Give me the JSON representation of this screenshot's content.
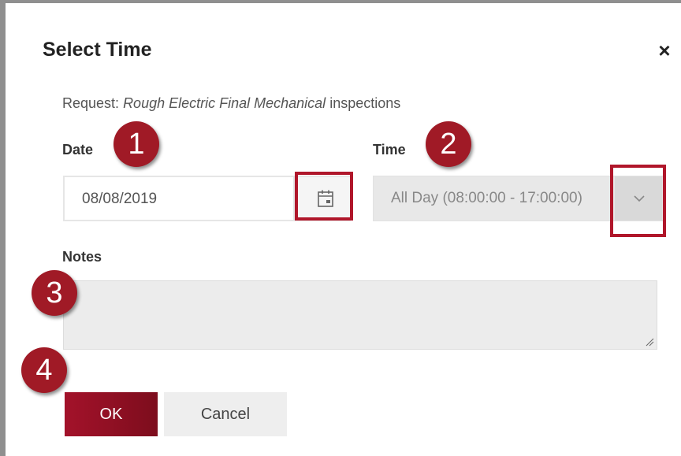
{
  "dialog": {
    "title": "Select Time",
    "close_label": "×",
    "request_prefix": "Request:",
    "request_types": "Rough Electric Final Mechanical",
    "request_suffix": "inspections"
  },
  "date": {
    "label": "Date",
    "value": "08/08/2019",
    "picker_icon": "calendar-icon"
  },
  "time": {
    "label": "Time",
    "value": "All Day (08:00:00 - 17:00:00)",
    "dropdown_icon": "chevron-down-icon"
  },
  "notes": {
    "label": "Notes",
    "value": ""
  },
  "buttons": {
    "ok": "OK",
    "cancel": "Cancel"
  },
  "annotations": [
    "1",
    "2",
    "3",
    "4"
  ],
  "colors": {
    "accent": "#a3122a",
    "badge": "#a01a26",
    "highlight": "#b0162a"
  }
}
